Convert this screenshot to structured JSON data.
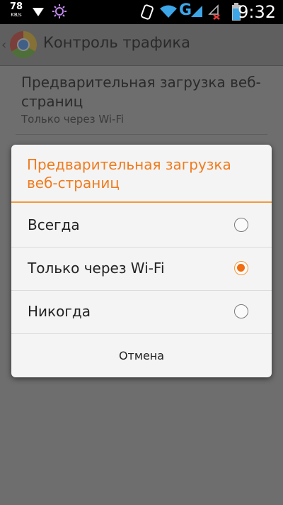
{
  "status_bar": {
    "speed_value": "78",
    "speed_unit": "KB/s",
    "network_type": "G",
    "clock": "9:32",
    "icons": [
      "download-arrow-icon",
      "weather-icon",
      "nfc-icon",
      "wifi-icon",
      "signal-1-icon",
      "signal-2-no-service-icon",
      "battery-icon"
    ]
  },
  "action_bar": {
    "title": "Контроль трафика",
    "app_icon": "chrome-logo-icon"
  },
  "background_list": {
    "item_title": "Предварительная загрузка веб-страниц",
    "item_summary": "Только через Wi-Fi"
  },
  "dialog": {
    "title": "Предварительная загрузка веб-страниц",
    "accent_color": "#f07b1d",
    "options": [
      {
        "label": "Всегда",
        "checked": false
      },
      {
        "label": "Только через Wi-Fi",
        "checked": true
      },
      {
        "label": "Никогда",
        "checked": false
      }
    ],
    "cancel_label": "Отмена"
  }
}
